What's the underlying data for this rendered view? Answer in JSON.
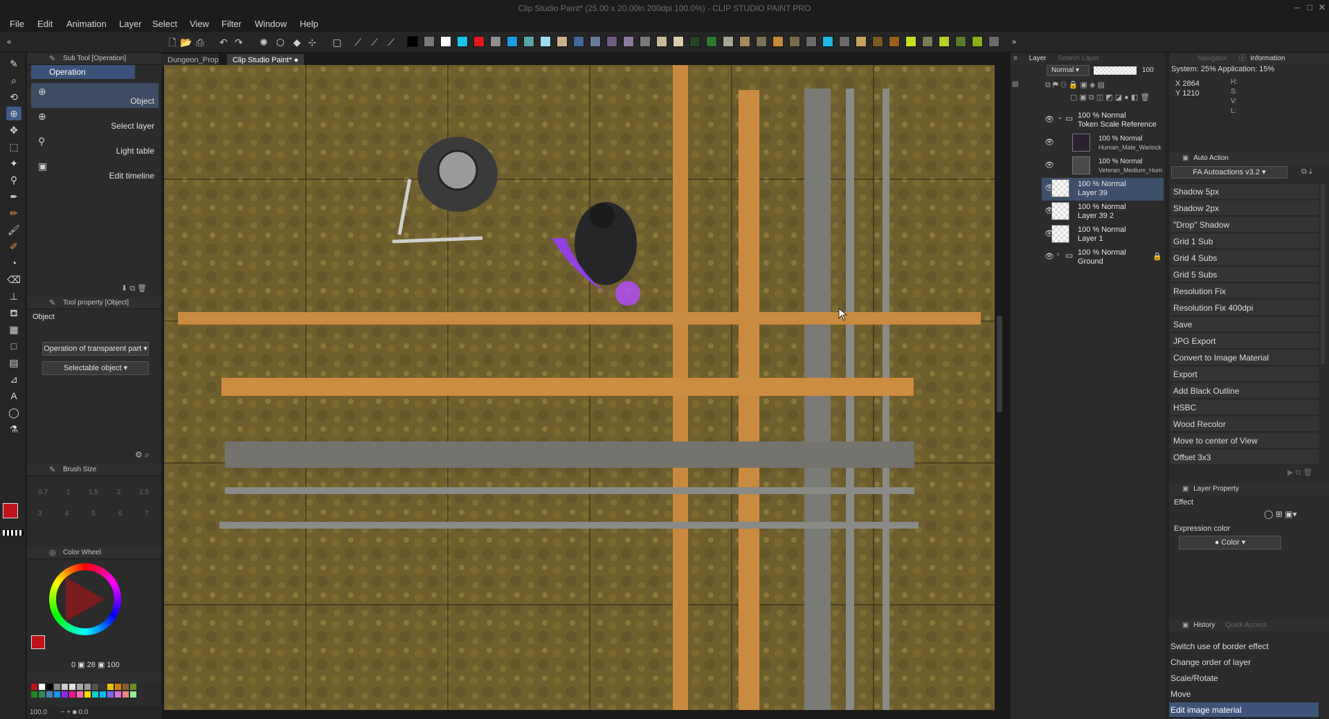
{
  "window": {
    "title": "Clip Studio Paint* (25.00 x 20.00in 200dpi 100.0%) - CLIP STUDIO PAINT PRO"
  },
  "menu": [
    "File",
    "Edit",
    "Animation",
    "Layer",
    "Select",
    "View",
    "Filter",
    "Window",
    "Help"
  ],
  "palette_colors": [
    "#000000",
    "#7a7a7a",
    "#ffffff",
    "#19c3ea",
    "#e3181f",
    "#8f8f8f",
    "#1a9be0",
    "#5aa5a5",
    "#9edcf1",
    "#c9b08a",
    "#41689a",
    "#6a7a9a",
    "#705b85",
    "#8a7aa0",
    "#7a7a7a",
    "#c9bb9a",
    "#d9cfae",
    "#244424",
    "#2f7a2f",
    "#a7a596",
    "#a78a5c",
    "#7a7055",
    "#c58a3a",
    "#7b6a4a",
    "#6a6a6a",
    "#1fb5e5",
    "#6a6a6a",
    "#c9a25a",
    "#7a5a20",
    "#9a5e1e",
    "#c6e01e",
    "#787a5a",
    "#b7cf28",
    "#5b7a2a",
    "#8ab01e",
    "#6a6a6a"
  ],
  "doc_tabs": [
    "Dungeon_Prop...",
    "Clip Studio Paint*"
  ],
  "subtool": {
    "header": "Sub Tool [Operation]",
    "tab": "Operation",
    "items": [
      "Object",
      "Select layer",
      "Light table",
      "Edit timeline"
    ]
  },
  "tool_property": {
    "header": "Tool property [Object]",
    "section": "Object",
    "dropdown1": "Operation of transparent part",
    "dropdown2": "Selectable object"
  },
  "brush_size": {
    "header": "Brush Size",
    "row1": [
      "0.7",
      "1",
      "1.5",
      "2",
      "2.5"
    ],
    "row2": [
      "3",
      "4",
      "5",
      "6",
      "7"
    ]
  },
  "color_wheel": {
    "header": "Color Wheel",
    "values": [
      "0",
      "28",
      "100"
    ],
    "main_color": "#c0141a"
  },
  "status": {
    "zoom": "100.0",
    "angle": "0.0"
  },
  "layer_panel": {
    "tab": "Layer",
    "search_tab": "Search Layer",
    "blend_mode": "Normal",
    "opacity": "100",
    "layers": [
      {
        "mode": "100 % Normal",
        "name": "Token Scale Reference"
      },
      {
        "mode": "100 % Normal",
        "name": "Human_Male_Warlock"
      },
      {
        "mode": "100 % Normal",
        "name": "Veteran_Medium_Hum"
      },
      {
        "mode": "100 % Normal",
        "name": "Layer 39"
      },
      {
        "mode": "100 % Normal",
        "name": "Layer 39 2"
      },
      {
        "mode": "100 % Normal",
        "name": "Layer 1"
      },
      {
        "mode": "100 % Normal",
        "name": "Ground"
      }
    ]
  },
  "info_panel": {
    "navigator_tab": "Navigator",
    "info_tab": "Information",
    "system": "System: 25%  Application: 15%",
    "x": "X 2864",
    "y": "Y 1210",
    "h": "H:",
    "s": "S:",
    "v": "V:",
    "l": "L:"
  },
  "auto_action": {
    "header": "Auto Action",
    "set": "FA Autoactions v3.2",
    "items": [
      "Shadow 5px",
      "Shadow 2px",
      "\"Drop\" Shadow",
      "Grid 1 Sub",
      "Grid 4 Subs",
      "Grid 5 Subs",
      "Resolution Fix",
      "Resolution Fix 400dpi",
      "Save",
      "JPG Export",
      "Convert to Image Material",
      "Export",
      "Add Black Outline",
      "HSBC",
      "Wood Recolor",
      "Move to center of View",
      "Offset 3x3"
    ]
  },
  "layer_property": {
    "header": "Layer Property",
    "effect": "Effect",
    "expression_color": "Expression color",
    "color_value": "Color"
  },
  "history": {
    "tab": "History",
    "quick_tab": "Quick Access",
    "items": [
      "Switch use of border effect",
      "Change order of layer",
      "Scale/Rotate",
      "Move",
      "Edit image material"
    ]
  }
}
